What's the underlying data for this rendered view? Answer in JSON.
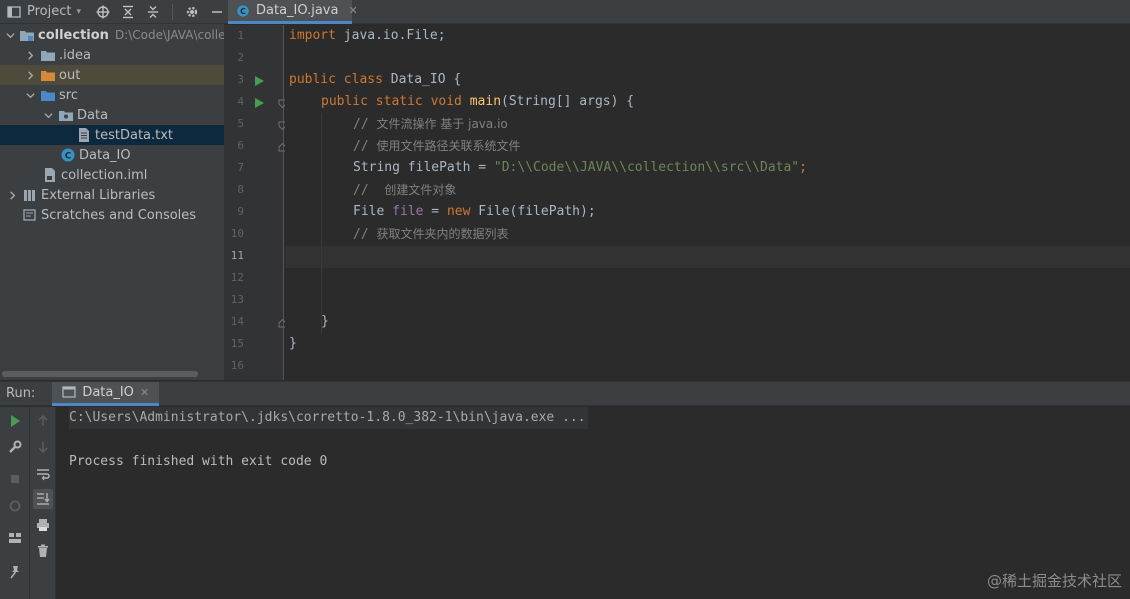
{
  "project_panel": {
    "title": "Project",
    "tree": [
      {
        "label": "collection",
        "path": "D:\\Code\\JAVA\\colle",
        "icon": "module-folder-icon"
      },
      {
        "label": ".idea",
        "icon": "folder-icon"
      },
      {
        "label": "out",
        "icon": "folder-orange-icon"
      },
      {
        "label": "src",
        "icon": "source-folder-icon"
      },
      {
        "label": "Data",
        "icon": "package-folder-icon"
      },
      {
        "label": "testData.txt",
        "icon": "text-file-icon"
      },
      {
        "label": "Data_IO",
        "icon": "java-class-icon"
      },
      {
        "label": "collection.iml",
        "icon": "iml-file-icon"
      },
      {
        "label": "External Libraries",
        "icon": "libraries-icon"
      },
      {
        "label": "Scratches and Consoles",
        "icon": "scratches-icon"
      }
    ]
  },
  "editor": {
    "tab_label": "Data_IO.java",
    "line_numbers": [
      "1",
      "2",
      "3",
      "4",
      "5",
      "6",
      "7",
      "8",
      "9",
      "10",
      "11",
      "12",
      "13",
      "14",
      "15",
      "16"
    ],
    "current_line": "11",
    "code": {
      "l1_kw": "import",
      "l1_rest": " java.io.File;",
      "l3_kw": "public class",
      "l3_rest": " Data_IO {",
      "l4_kw": "public static void",
      "l4_fn": "main",
      "l4_rest": "(String[] args) {",
      "l5_slash": "// ",
      "l5_text": "文件流操作 基于 java.io",
      "l6_slash": "// ",
      "l6_text": "使用文件路径关联系统文件",
      "l7_pre": "String filePath = ",
      "l7_str": "\"D:\\\\Code\\\\JAVA\\\\collection\\\\src\\\\Data\"",
      "l7_end": ";",
      "l8_slash": "//  ",
      "l8_text": "创建文件对象",
      "l9_pre": "File ",
      "l9_var": "file",
      "l9_mid": " = ",
      "l9_kw": "new",
      "l9_rest": " File(filePath);",
      "l10_slash": "// ",
      "l10_text": "获取文件夹内的数据列表",
      "l14_text": "}",
      "l15_text": "}"
    }
  },
  "run_panel": {
    "label": "Run:",
    "tab_label": "Data_IO",
    "console_lines": [
      "C:\\Users\\Administrator\\.jdks\\corretto-1.8.0_382-1\\bin\\java.exe ...",
      "",
      "Process finished with exit code 0"
    ]
  },
  "watermark": "@稀土掘金技术社区",
  "colors": {
    "accent": "#4a88c7",
    "keyword": "#cc7832",
    "string": "#6a8759",
    "comment": "#808080",
    "function": "#ffc66d"
  }
}
